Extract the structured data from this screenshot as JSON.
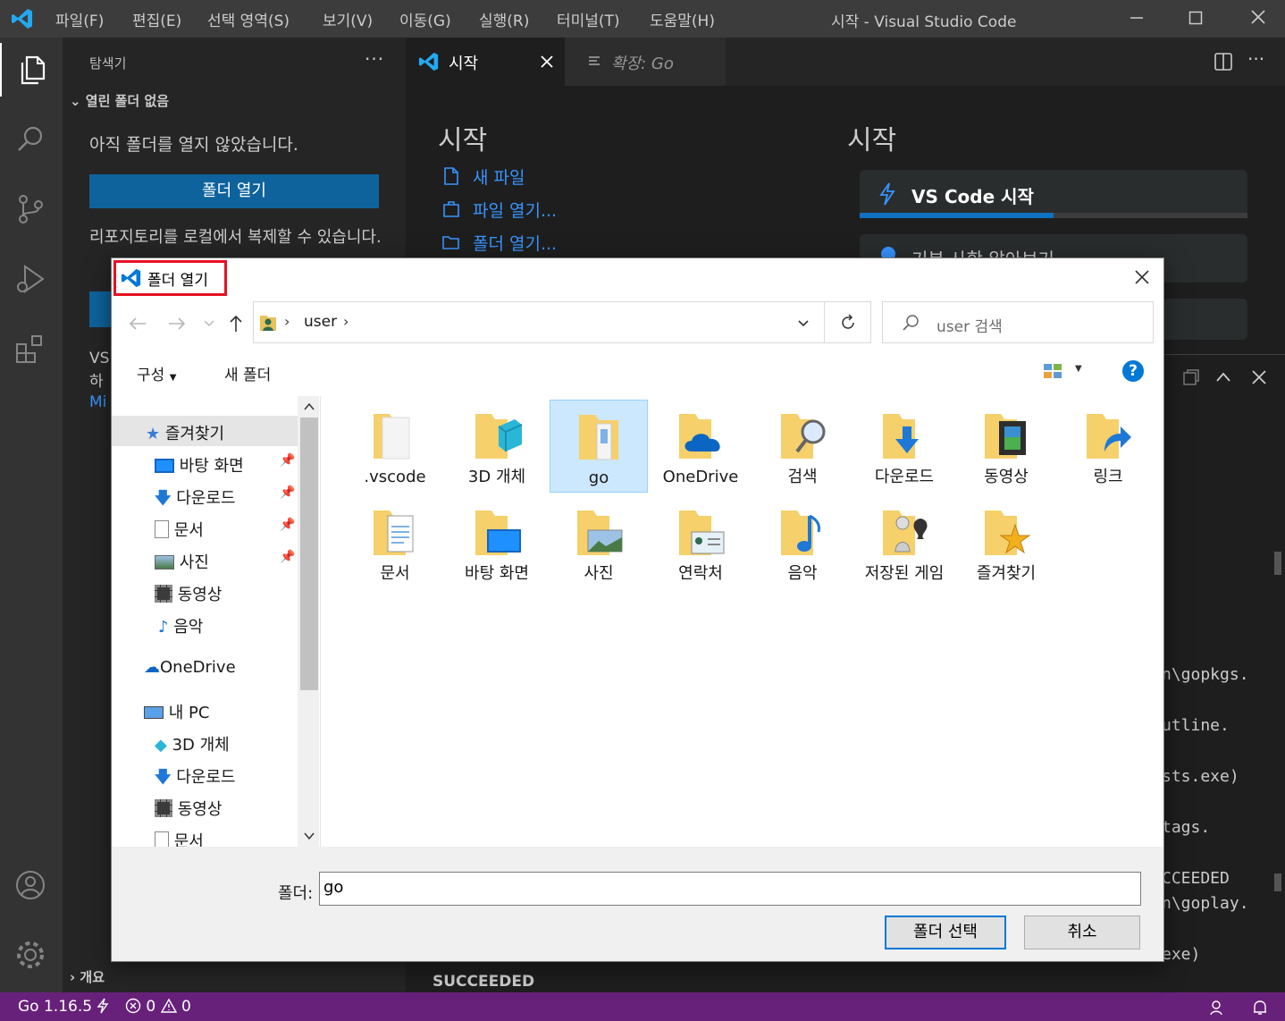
{
  "window": {
    "title": "시작 - Visual Studio Code",
    "menu": [
      "파일(F)",
      "편집(E)",
      "선택 영역(S)",
      "보기(V)",
      "이동(G)",
      "실행(R)",
      "터미널(T)",
      "도움말(H)"
    ]
  },
  "sidebar": {
    "header": "탐색기",
    "section": "열린 폴더 없음",
    "message": "아직 폴더를 열지 않았습니다.",
    "open_folder_button": "폴더 열기",
    "clone_message": "리포지토리를 로컬에서 복제할 수 있습니다.",
    "vs_text": "VS",
    "ha_text": "하",
    "mi_text": "Mi",
    "outline": "개요"
  },
  "tabs": [
    {
      "label": "시작"
    },
    {
      "label": "확장: Go"
    }
  ],
  "editor": {
    "start_heading_left": "시작",
    "links": [
      "새 파일",
      "파일 열기...",
      "폴더 열기..."
    ],
    "start_heading_right": "시작",
    "walkthrough_1": "VS Code 시작",
    "walkthrough_2": "기본 사항 알아보기",
    "walkthrough_progress": 0.5,
    "terminal_lines": [
      "n\\gopkgs.",
      "utline.",
      "sts.exe)",
      "tags.",
      "CCEEDED",
      "n\\goplay.",
      "exe)"
    ],
    "terminal_bottom": "SUCCEEDED"
  },
  "status": {
    "go_version": "Go 1.16.5",
    "errors": "0",
    "warnings": "0"
  },
  "dialog": {
    "title": "폴더 열기",
    "breadcrumb": "user",
    "search_placeholder": "user 검색",
    "organize": "구성",
    "new_folder": "새 폴더",
    "help": "?",
    "tree": [
      {
        "label": "즐겨찾기",
        "icon": "star-icon"
      },
      {
        "label": "바탕 화면",
        "icon": "desktop-icon"
      },
      {
        "label": "다운로드",
        "icon": "download-icon"
      },
      {
        "label": "문서",
        "icon": "document-icon"
      },
      {
        "label": "사진",
        "icon": "picture-icon"
      },
      {
        "label": "동영상",
        "icon": "video-icon"
      },
      {
        "label": "음악",
        "icon": "music-icon"
      },
      {
        "label": "OneDrive",
        "icon": "cloud-icon"
      },
      {
        "label": "내 PC",
        "icon": "pc-icon"
      },
      {
        "label": "3D 개체",
        "icon": "cube-icon"
      },
      {
        "label": "다운로드",
        "icon": "download-icon"
      },
      {
        "label": "동영상",
        "icon": "video-icon"
      },
      {
        "label": "문서",
        "icon": "document-icon"
      }
    ],
    "files": [
      {
        "label": ".vscode",
        "icon": "folder-icon"
      },
      {
        "label": "3D 개체",
        "icon": "folder-3d-icon"
      },
      {
        "label": "go",
        "icon": "folder-icon"
      },
      {
        "label": "OneDrive",
        "icon": "folder-onedrive-icon"
      },
      {
        "label": "검색",
        "icon": "folder-search-icon"
      },
      {
        "label": "다운로드",
        "icon": "folder-download-icon"
      },
      {
        "label": "동영상",
        "icon": "folder-video-icon"
      },
      {
        "label": "링크",
        "icon": "folder-link-icon"
      },
      {
        "label": "문서",
        "icon": "folder-document-icon"
      },
      {
        "label": "바탕 화면",
        "icon": "folder-desktop-icon"
      },
      {
        "label": "사진",
        "icon": "folder-picture-icon"
      },
      {
        "label": "연락처",
        "icon": "folder-contact-icon"
      },
      {
        "label": "음악",
        "icon": "folder-music-icon"
      },
      {
        "label": "저장된 게임",
        "icon": "folder-games-icon"
      },
      {
        "label": "즐겨찾기",
        "icon": "folder-favorites-icon"
      }
    ],
    "folder_label": "폴더:",
    "folder_value": "go",
    "select_button": "폴더 선택",
    "cancel_button": "취소"
  },
  "colors": {
    "accent": "#0e639c",
    "statusbar": "#68217a",
    "link": "#3794ff",
    "highlight": "#e81123"
  }
}
